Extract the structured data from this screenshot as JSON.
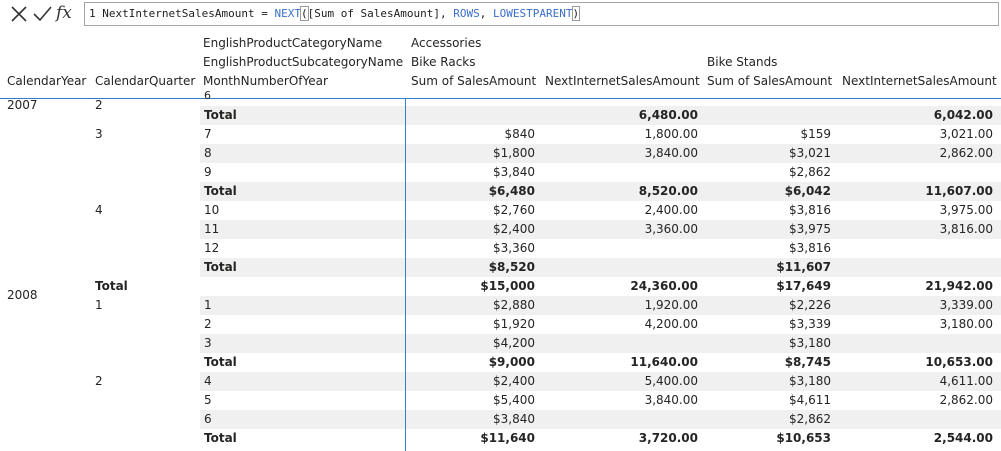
{
  "formula": {
    "line_no": "1",
    "measure": "NextInternetSalesAmount",
    "equals": " = ",
    "fn": "NEXT",
    "open": "(",
    "arg1": "[Sum of SalesAmount], ",
    "kw1": "ROWS",
    "sep": ", ",
    "kw2": "LOWESTPARENT",
    "close": ")"
  },
  "headers": {
    "category_field": "EnglishProductCategoryName",
    "subcategory_field": "EnglishProductSubcategoryName",
    "month_field": "MonthNumberOfYear",
    "year_col": "CalendarYear",
    "quarter_col": "CalendarQuarter",
    "category_value": "Accessories",
    "sub1": "Bike Racks",
    "sub2": "Bike Stands",
    "measure1": "Sum of SalesAmount",
    "measure2": "NextInternetSalesAmount",
    "measure3": "Sum of SalesAmount",
    "measure4": "NextInternetSalesAmount"
  },
  "year_labels": [
    {
      "text": "2007",
      "row": 0
    },
    {
      "text": "2008",
      "row": 10
    }
  ],
  "quarter_labels": [
    {
      "text": "2",
      "row": 0,
      "bold": false
    },
    {
      "text": "3",
      "row": 1,
      "bold": false
    },
    {
      "text": "4",
      "row": 5,
      "bold": false
    },
    {
      "text": "Total",
      "row": 9,
      "bold": true
    },
    {
      "text": "1",
      "row": 10,
      "bold": false
    },
    {
      "text": "2",
      "row": 14,
      "bold": false
    }
  ],
  "rows": [
    {
      "month": "Total",
      "v1": "",
      "v2": "6,480.00",
      "v3": "",
      "v4": "6,042.00",
      "bold": true,
      "shade": true
    },
    {
      "month": "7",
      "v1": "$840",
      "v2": "1,800.00",
      "v3": "$159",
      "v4": "3,021.00",
      "bold": false,
      "shade": false
    },
    {
      "month": "8",
      "v1": "$1,800",
      "v2": "3,840.00",
      "v3": "$3,021",
      "v4": "2,862.00",
      "bold": false,
      "shade": true
    },
    {
      "month": "9",
      "v1": "$3,840",
      "v2": "",
      "v3": "$2,862",
      "v4": "",
      "bold": false,
      "shade": false
    },
    {
      "month": "Total",
      "v1": "$6,480",
      "v2": "8,520.00",
      "v3": "$6,042",
      "v4": "11,607.00",
      "bold": true,
      "shade": true
    },
    {
      "month": "10",
      "v1": "$2,760",
      "v2": "2,400.00",
      "v3": "$3,816",
      "v4": "3,975.00",
      "bold": false,
      "shade": false
    },
    {
      "month": "11",
      "v1": "$2,400",
      "v2": "3,360.00",
      "v3": "$3,975",
      "v4": "3,816.00",
      "bold": false,
      "shade": true
    },
    {
      "month": "12",
      "v1": "$3,360",
      "v2": "",
      "v3": "$3,816",
      "v4": "",
      "bold": false,
      "shade": false
    },
    {
      "month": "Total",
      "v1": "$8,520",
      "v2": "",
      "v3": "$11,607",
      "v4": "",
      "bold": true,
      "shade": true
    },
    {
      "month": "",
      "v1": "$15,000",
      "v2": "24,360.00",
      "v3": "$17,649",
      "v4": "21,942.00",
      "bold": true,
      "shade": false
    },
    {
      "month": "1",
      "v1": "$2,880",
      "v2": "1,920.00",
      "v3": "$2,226",
      "v4": "3,339.00",
      "bold": false,
      "shade": true
    },
    {
      "month": "2",
      "v1": "$1,920",
      "v2": "4,200.00",
      "v3": "$3,339",
      "v4": "3,180.00",
      "bold": false,
      "shade": false
    },
    {
      "month": "3",
      "v1": "$4,200",
      "v2": "",
      "v3": "$3,180",
      "v4": "",
      "bold": false,
      "shade": true
    },
    {
      "month": "Total",
      "v1": "$9,000",
      "v2": "11,640.00",
      "v3": "$8,745",
      "v4": "10,653.00",
      "bold": true,
      "shade": false
    },
    {
      "month": "4",
      "v1": "$2,400",
      "v2": "5,400.00",
      "v3": "$3,180",
      "v4": "4,611.00",
      "bold": false,
      "shade": true
    },
    {
      "month": "5",
      "v1": "$5,400",
      "v2": "3,840.00",
      "v3": "$4,611",
      "v4": "2,862.00",
      "bold": false,
      "shade": false
    },
    {
      "month": "6",
      "v1": "$3,840",
      "v2": "",
      "v3": "$2,862",
      "v4": "",
      "bold": false,
      "shade": true
    },
    {
      "month": "Total",
      "v1": "$11,640",
      "v2": "3,720.00",
      "v3": "$10,653",
      "v4": "2,544.00",
      "bold": true,
      "shade": false
    }
  ],
  "colors": {
    "accent_line": "#2f7fd1",
    "shade_row": "#f0f0f0",
    "dax_keyword": "#3a6fc9"
  }
}
